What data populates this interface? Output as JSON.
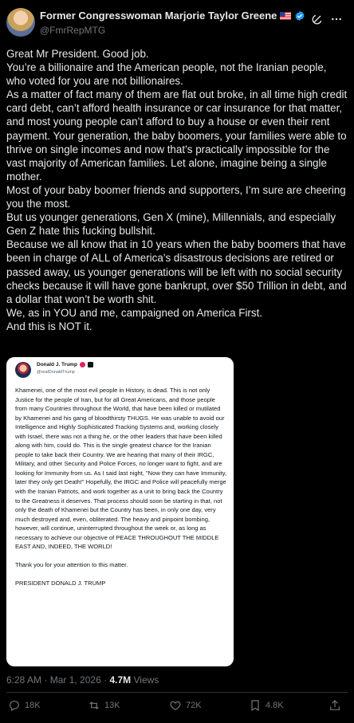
{
  "post": {
    "display_name": "Former Congresswoman Marjorie Taylor Greene",
    "handle": "@FmrRepMTG",
    "paragraphs": [
      "Great Mr President. Good job.",
      "You’re a billionaire and the American people, not the Iranian people, who voted for you are not billionaires.",
      "As a matter of fact many of them are flat out broke, in all time high credit card debt, can’t afford health insurance or car insurance for that matter, and most young people can’t afford to buy a house or even their rent payment. Your generation, the baby boomers, your families were able to thrive on single incomes and now that’s practically impossible for the vast majority of American families. Let alone, imagine being a single mother.",
      "Most of your baby boomer friends and supporters, I’m sure are cheering you the most.",
      "But us younger generations, Gen X (mine), Millennials, and especially Gen Z hate this fucking bullshit.",
      "Because we all know that in 10 years when the baby boomers that have been in charge of ALL of America’s disastrous decisions are retired or passed away, us younger generations will be left with no social security checks because it will have gone bankrupt, over $50 Trillion in debt, and a dollar that won’t be worth shit.",
      "We, as in YOU and me, campaigned on America First.",
      "And this is NOT it."
    ],
    "time": "6:28 AM",
    "date": "Mar 1, 2026",
    "views_count": "4.7M",
    "views_label": "Views"
  },
  "embedded": {
    "display_name": "Donald J. Trump",
    "handle": "@realDonaldTrump",
    "body": "Khamenei, one of the most evil people in History, is dead. This is not only Justice for the people of Iran, but for all Great Americans, and those people from many Countries throughout the World, that have been killed or mutilated by Khamenei and his gang of bloodthirsty THUGS. He was unable to avoid our Intelligence and Highly Sophisticated Tracking Systems and, working closely with Israel, there was not a thing he, or the other leaders that have been killed along with him, could do. This is the single greatest chance for the Iranian people to take back their Country. We are hearing that many of their IRGC, Military, and other Security and Police Forces, no longer want to fight, and are looking for Immunity from us. As I said last night, \"Now they can have Immunity, later they only get Death!\" Hopefully, the IRGC and Police will peacefully merge with the Iranian Patriots, and work together as a unit to bring back the Country to the Greatness it deserves. That process should soon be starting in that, not only the death of Khamenei but the Country has been, in only one day, very much destroyed and, even, obliterated. The heavy and pinpoint bombing, however, will continue, uninterrupted throughout the week or, as long as necessary to achieve our objective of PEACE THROUGHOUT THE MIDDLE EAST AND, INDEED, THE WORLD!",
    "thanks": "Thank you for your attention to this matter.",
    "signature": "PRESIDENT DONALD J. TRUMP"
  },
  "actions": {
    "replies": "18K",
    "reposts": "13K",
    "likes": "72K",
    "bookmarks": "4.8K"
  },
  "icons": {
    "flag": "us-flag-icon",
    "verified": "verified-badge-icon",
    "grok": "grok-icon",
    "more": "more-icon",
    "reply": "reply-icon",
    "repost": "repost-icon",
    "like": "like-icon",
    "bookmark": "bookmark-icon",
    "share": "share-icon"
  },
  "colors": {
    "background": "#000000",
    "text": "#e7e9ea",
    "muted": "#71767b",
    "verified": "#1d9bf0",
    "divider": "#2f3336"
  }
}
